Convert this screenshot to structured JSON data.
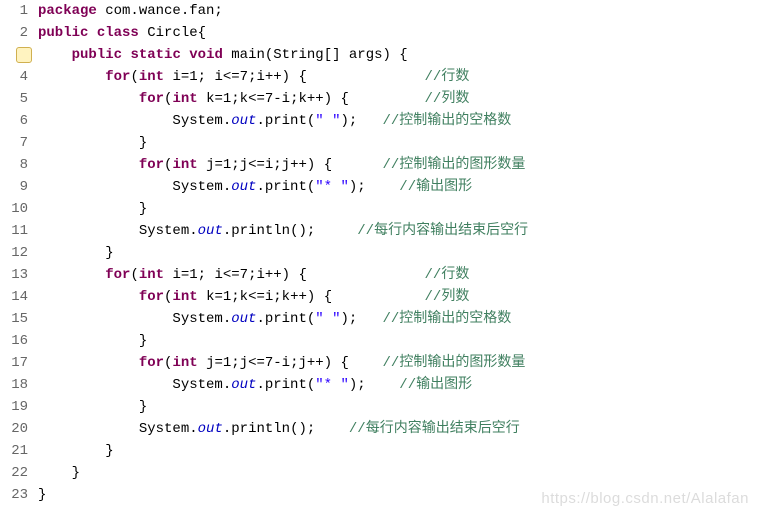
{
  "lines": [
    {
      "n": "1",
      "gutter": "num",
      "indent": "",
      "segs": [
        {
          "c": "kw",
          "t": "package"
        },
        {
          "c": "",
          "t": " com.wance.fan;"
        }
      ]
    },
    {
      "n": "2",
      "gutter": "num",
      "indent": "",
      "segs": [
        {
          "c": "kw",
          "t": "public"
        },
        {
          "c": "",
          "t": " "
        },
        {
          "c": "kw",
          "t": "class"
        },
        {
          "c": "",
          "t": " Circle{"
        }
      ]
    },
    {
      "n": "3",
      "gutter": "lamp",
      "indent": "    ",
      "segs": [
        {
          "c": "kw",
          "t": "public"
        },
        {
          "c": "",
          "t": " "
        },
        {
          "c": "kw",
          "t": "static"
        },
        {
          "c": "",
          "t": " "
        },
        {
          "c": "kw",
          "t": "void"
        },
        {
          "c": "",
          "t": " main(String[] args) {"
        }
      ]
    },
    {
      "n": "4",
      "gutter": "num",
      "indent": "        ",
      "segs": [
        {
          "c": "kw",
          "t": "for"
        },
        {
          "c": "",
          "t": "("
        },
        {
          "c": "kw",
          "t": "int"
        },
        {
          "c": "",
          "t": " i=1; i<=7;i++) {              "
        },
        {
          "c": "cmt",
          "t": "//行数"
        }
      ]
    },
    {
      "n": "5",
      "gutter": "num",
      "indent": "            ",
      "segs": [
        {
          "c": "kw",
          "t": "for"
        },
        {
          "c": "",
          "t": "("
        },
        {
          "c": "kw",
          "t": "int"
        },
        {
          "c": "",
          "t": " k=1;k<=7-i;k++) {         "
        },
        {
          "c": "cmt",
          "t": "//列数"
        }
      ]
    },
    {
      "n": "6",
      "gutter": "num",
      "indent": "                ",
      "segs": [
        {
          "c": "",
          "t": "System."
        },
        {
          "c": "fld",
          "t": "out"
        },
        {
          "c": "",
          "t": ".print("
        },
        {
          "c": "str",
          "t": "\" \""
        },
        {
          "c": "",
          "t": ");   "
        },
        {
          "c": "cmt",
          "t": "//控制输出的空格数"
        }
      ]
    },
    {
      "n": "7",
      "gutter": "num",
      "indent": "            ",
      "segs": [
        {
          "c": "",
          "t": "}"
        }
      ]
    },
    {
      "n": "8",
      "gutter": "num",
      "indent": "            ",
      "segs": [
        {
          "c": "kw",
          "t": "for"
        },
        {
          "c": "",
          "t": "("
        },
        {
          "c": "kw",
          "t": "int"
        },
        {
          "c": "",
          "t": " j=1;j<=i;j++) {      "
        },
        {
          "c": "cmt",
          "t": "//控制输出的图形数量"
        }
      ]
    },
    {
      "n": "9",
      "gutter": "num",
      "indent": "                ",
      "segs": [
        {
          "c": "",
          "t": "System."
        },
        {
          "c": "fld",
          "t": "out"
        },
        {
          "c": "",
          "t": ".print("
        },
        {
          "c": "str",
          "t": "\"* \""
        },
        {
          "c": "",
          "t": ");    "
        },
        {
          "c": "cmt",
          "t": "//输出图形"
        }
      ]
    },
    {
      "n": "10",
      "gutter": "num",
      "indent": "            ",
      "segs": [
        {
          "c": "",
          "t": "}"
        }
      ]
    },
    {
      "n": "11",
      "gutter": "num",
      "indent": "            ",
      "segs": [
        {
          "c": "",
          "t": "System."
        },
        {
          "c": "fld",
          "t": "out"
        },
        {
          "c": "",
          "t": ".println();     "
        },
        {
          "c": "cmt",
          "t": "//每行内容输出结束后空行"
        }
      ]
    },
    {
      "n": "12",
      "gutter": "num",
      "indent": "        ",
      "segs": [
        {
          "c": "",
          "t": "}"
        }
      ]
    },
    {
      "n": "13",
      "gutter": "num",
      "indent": "        ",
      "segs": [
        {
          "c": "kw",
          "t": "for"
        },
        {
          "c": "",
          "t": "("
        },
        {
          "c": "kw",
          "t": "int"
        },
        {
          "c": "",
          "t": " i=1; i<=7;i++) {              "
        },
        {
          "c": "cmt",
          "t": "//行数"
        }
      ]
    },
    {
      "n": "14",
      "gutter": "num",
      "indent": "            ",
      "segs": [
        {
          "c": "kw",
          "t": "for"
        },
        {
          "c": "",
          "t": "("
        },
        {
          "c": "kw",
          "t": "int"
        },
        {
          "c": "",
          "t": " k=1;k<=i;k++) {           "
        },
        {
          "c": "cmt",
          "t": "//列数"
        }
      ]
    },
    {
      "n": "15",
      "gutter": "num",
      "indent": "                ",
      "segs": [
        {
          "c": "",
          "t": "System."
        },
        {
          "c": "fld",
          "t": "out"
        },
        {
          "c": "",
          "t": ".print("
        },
        {
          "c": "str",
          "t": "\" \""
        },
        {
          "c": "",
          "t": ");   "
        },
        {
          "c": "cmt",
          "t": "//控制输出的空格数"
        }
      ]
    },
    {
      "n": "16",
      "gutter": "num",
      "indent": "            ",
      "segs": [
        {
          "c": "",
          "t": "}"
        }
      ]
    },
    {
      "n": "17",
      "gutter": "num",
      "indent": "            ",
      "segs": [
        {
          "c": "kw",
          "t": "for"
        },
        {
          "c": "",
          "t": "("
        },
        {
          "c": "kw",
          "t": "int"
        },
        {
          "c": "",
          "t": " j=1;j<=7-i;j++) {    "
        },
        {
          "c": "cmt",
          "t": "//控制输出的图形数量"
        }
      ]
    },
    {
      "n": "18",
      "gutter": "num",
      "indent": "                ",
      "segs": [
        {
          "c": "",
          "t": "System."
        },
        {
          "c": "fld",
          "t": "out"
        },
        {
          "c": "",
          "t": ".print("
        },
        {
          "c": "str",
          "t": "\"* \""
        },
        {
          "c": "",
          "t": ");    "
        },
        {
          "c": "cmt",
          "t": "//输出图形"
        }
      ]
    },
    {
      "n": "19",
      "gutter": "num",
      "indent": "            ",
      "segs": [
        {
          "c": "",
          "t": "}"
        }
      ]
    },
    {
      "n": "20",
      "gutter": "num",
      "indent": "            ",
      "segs": [
        {
          "c": "",
          "t": "System."
        },
        {
          "c": "fld",
          "t": "out"
        },
        {
          "c": "",
          "t": ".println();    "
        },
        {
          "c": "cmt",
          "t": "//每行内容输出结束后空行"
        }
      ]
    },
    {
      "n": "21",
      "gutter": "num",
      "indent": "        ",
      "segs": [
        {
          "c": "",
          "t": "}"
        }
      ]
    },
    {
      "n": "22",
      "gutter": "num",
      "indent": "    ",
      "segs": [
        {
          "c": "",
          "t": "}"
        }
      ]
    },
    {
      "n": "23",
      "gutter": "num",
      "indent": "",
      "segs": [
        {
          "c": "",
          "t": "}"
        }
      ]
    }
  ],
  "watermark": "https://blog.csdn.net/Alalafan"
}
